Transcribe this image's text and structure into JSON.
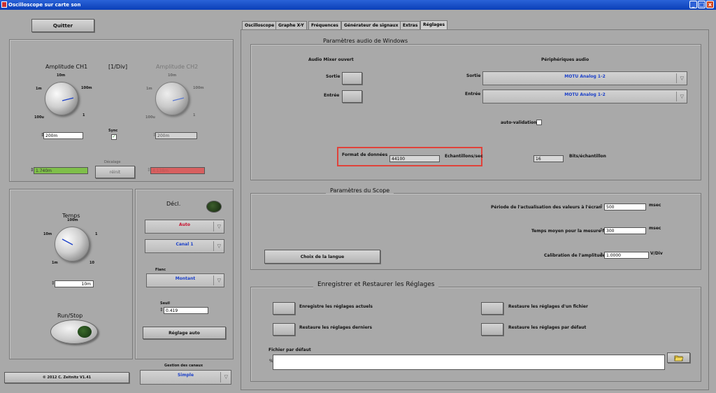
{
  "window": {
    "title": "Oscilloscope sur carte son",
    "min": "_",
    "max": "□",
    "close": "x"
  },
  "left": {
    "quit": "Quitter",
    "amp_ch1": "Amplitude CH1",
    "per_div": "[1/Div]",
    "amp_ch2": "Amplitude CH2",
    "knob_ticks": {
      "t10m": "10m",
      "t1m": "1m",
      "t100m": "100m",
      "t100u": "100u",
      "t1": "1"
    },
    "ch1_value": "200m",
    "ch2_value": "200m",
    "sync": "Sync",
    "sync_checked": "✓",
    "decalage": "Décalage",
    "reinit": "réinit",
    "offset1": "1.740m",
    "offset2": "4.138m",
    "temps": "Temps",
    "time_ticks": {
      "t100m": "100m",
      "t10m": "10m",
      "t1": "1",
      "t1m": "1m",
      "t10": "10"
    },
    "time_value": "10m",
    "runstop": "Run/Stop",
    "copyright": "© 2012  C. Zeitnitz V1.41"
  },
  "trigger": {
    "title": "Décl.",
    "mode": "Auto",
    "channel": "Canal 1",
    "flanc_label": "Flanc",
    "flanc": "Montant",
    "seuil_label": "Seuil",
    "seuil": "0.419",
    "auto_btn": "Réglage auto",
    "gestion_label": "Gestion des canaux",
    "gestion": "Simple",
    "colors": {
      "mode": "#c8102e",
      "channel": "#1a3fc9",
      "led": "#1c3a16"
    }
  },
  "tabs": [
    "Oscilloscope",
    "Graphe X-Y",
    "Fréquences",
    "Générateur de signaux",
    "Extras",
    "Réglages"
  ],
  "audio": {
    "title": "Paramètres audio de Windows",
    "mixer": "Audio Mixer ouvert",
    "sortie": "Sortie",
    "entree": "Entrée",
    "peripheriques": "Périphériques audio",
    "out_device": "MOTU Analog 1-2",
    "in_device": "MOTU Analog 1-2",
    "autovalid": "auto-validation",
    "format_label": "Format de données",
    "format_value": "44100",
    "echant": "Echantillons/sec",
    "bits_value": "16",
    "bits_label": "Bits/échantillon"
  },
  "scope": {
    "title": "Paramètres du Scope",
    "periode_label": "Période de l'actualisation des valeurs à l'écran",
    "periode_value": "500",
    "periode_unit": "msec",
    "temps_label": "Temps moyen pour la mesure f",
    "temps_value": "300",
    "temps_unit": "msec",
    "langue": "Choix de la langue",
    "calib_label": "Calibration de l'amplitude",
    "calib_value": "1.0000",
    "calib_unit": "V/Div"
  },
  "save": {
    "title": "Enregistrer et Restaurer les Réglages",
    "save_current": "Enregistre les réglages actuels",
    "restore_last": "Restaure les réglages derniers",
    "restore_file": "Restaure les réglages d'un fichier",
    "restore_default": "Restaure les réglages par défaut",
    "default_file_label": "Fichier par défaut",
    "default_file": "",
    "path_prefix": "%"
  },
  "colors": {
    "highlight": "#e0423a",
    "offset1_bg": "#7fbf4a",
    "offset2_bg": "#d86060"
  }
}
